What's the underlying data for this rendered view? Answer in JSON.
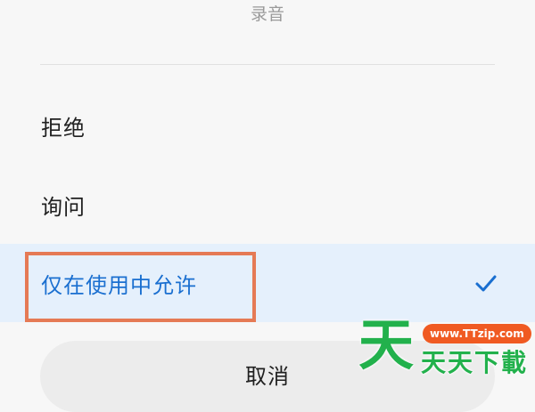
{
  "dialog": {
    "title": "录音",
    "options": [
      {
        "label": "拒绝",
        "selected": false
      },
      {
        "label": "询问",
        "selected": false
      },
      {
        "label": "仅在使用中允许",
        "selected": true
      }
    ],
    "cancel_label": "取消",
    "selected_icon": "check-icon"
  },
  "watermark": {
    "logo_char": "天",
    "url": "www.TTzip.com",
    "name": "天天下載"
  },
  "colors": {
    "accent": "#1a6fd0",
    "selected_row_background": "#e5f0fc",
    "highlight_frame": "#e57a55",
    "watermark_green": "#22b14c",
    "watermark_badge": "#f05a22"
  }
}
